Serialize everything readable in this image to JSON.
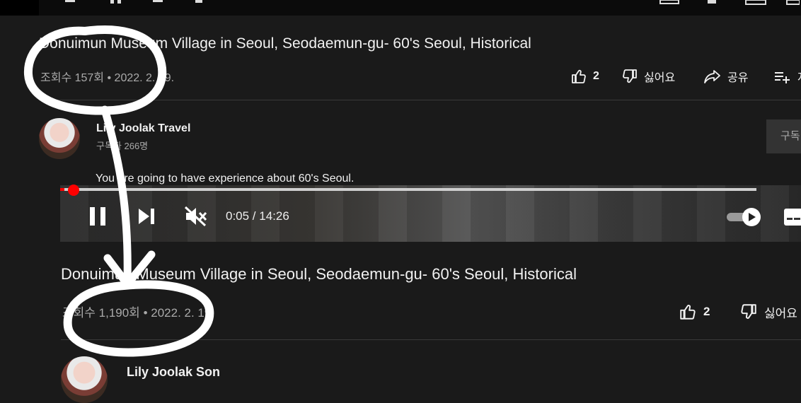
{
  "first_view": {
    "title": "Donuimun Museum Village in Seoul, Seodaemun-gu- 60's Seoul, Historical",
    "views": "조회수 157회",
    "separator": "•",
    "date": "2022. 2. 19.",
    "like_count": "2",
    "dislike_label": "싫어요",
    "share_label": "공유",
    "save_label": "저"
  },
  "channel": {
    "name": "Lily Joolak Travel",
    "subscribers": "구독자 266명",
    "subscribe_label": "구독"
  },
  "description": "You are going to have experience about 60's Seoul.",
  "player": {
    "time": "0:05 / 14:26",
    "progress": 0.006
  },
  "second_view": {
    "title": "Donuimun Museum Village in Seoul, Seodaemun-gu- 60's Seoul, Historical",
    "views": "조회수 1,190회",
    "separator": "•",
    "date": "2022. 2. 19.",
    "like_count": "2",
    "dislike_label": "싫어요",
    "channel_name": "Lily Joolak Son"
  },
  "annotation": {
    "color": "#ffffff"
  }
}
